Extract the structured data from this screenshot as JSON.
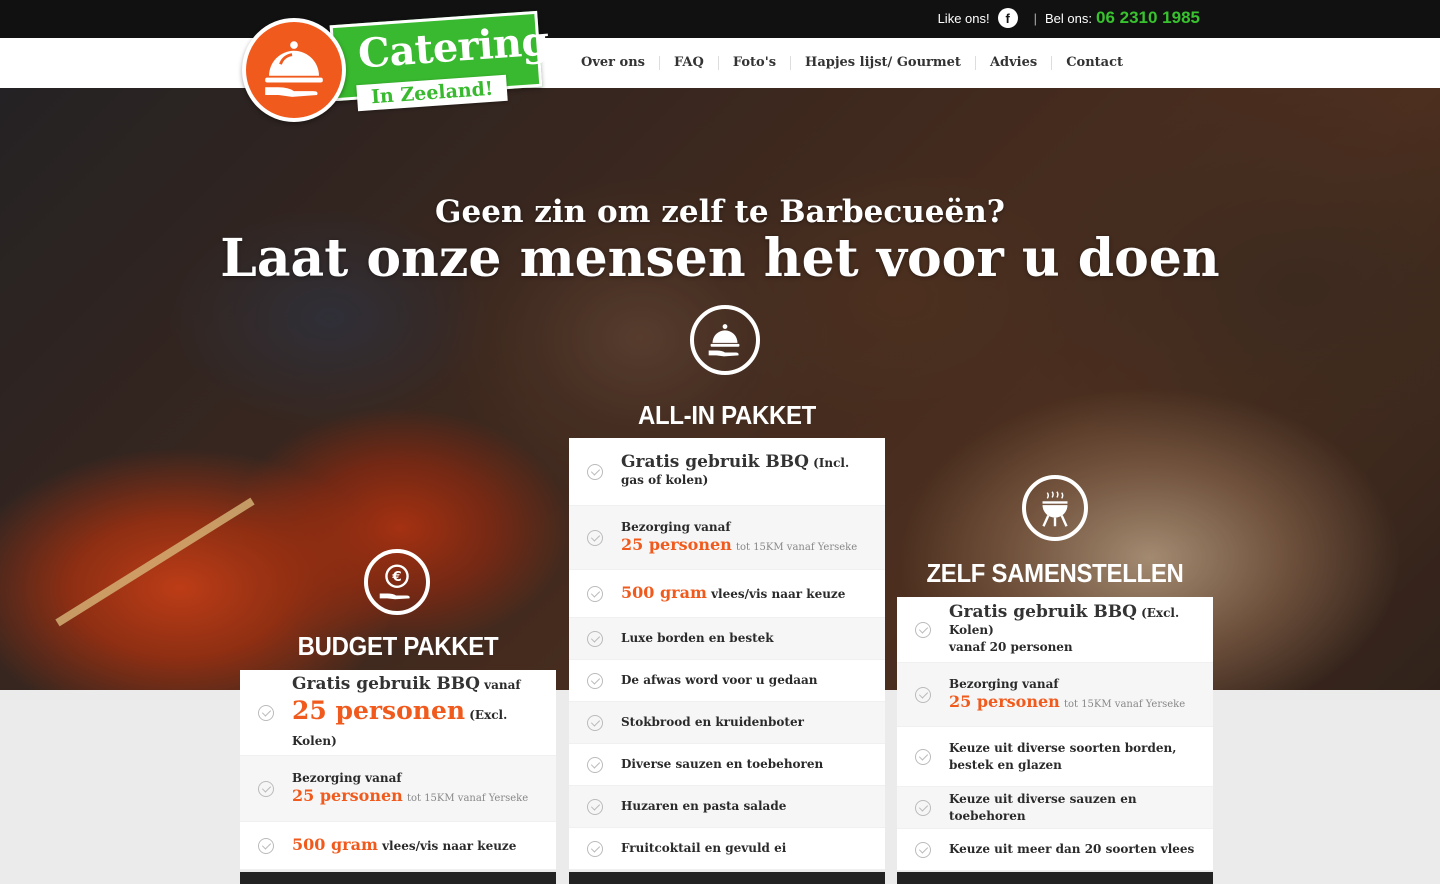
{
  "topbar": {
    "like_label": "Like ons!",
    "fb_icon": "f",
    "separator": "|",
    "call_label": "Bel ons:",
    "phone": "06 2310 1985"
  },
  "logo": {
    "title": "Catering",
    "subtitle": "In Zeeland!"
  },
  "nav": {
    "items": [
      "Over ons",
      "FAQ",
      "Foto's",
      "Hapjes lijst/ Gourmet",
      "Advies",
      "Contact"
    ]
  },
  "hero": {
    "subtitle": "Geen zin om zelf te Barbecueën?",
    "title": "Laat onze mensen het voor u doen"
  },
  "packages": {
    "budget": {
      "title": "BUDGET PAKKET",
      "icon": "euro-hand-icon",
      "rows": [
        {
          "a": "Gratis gebruik BBQ",
          "b": "vanaf",
          "c": "25 personen",
          "d": "(Excl. Kolen)"
        },
        {
          "a": "Bezorging vanaf",
          "b": "25 personen",
          "c": "tot 15KM vanaf Yerseke"
        },
        {
          "a": "500 gram",
          "b": "vlees/vis naar keuze"
        }
      ]
    },
    "allin": {
      "title": "ALL-IN PAKKET",
      "icon": "cloche-hand-icon",
      "rows": [
        {
          "a": "Gratis gebruik BBQ",
          "b": "(Incl. gas of kolen)"
        },
        {
          "a": "Bezorging vanaf",
          "b": "25 personen",
          "c": "tot 15KM vanaf Yerseke"
        },
        {
          "a": "500 gram",
          "b": "vlees/vis naar keuze"
        },
        {
          "a": "Luxe borden en bestek"
        },
        {
          "a": "De afwas word voor u gedaan"
        },
        {
          "a": "Stokbrood en kruidenboter"
        },
        {
          "a": "Diverse sauzen en toebehoren"
        },
        {
          "a": "Huzaren en pasta salade"
        },
        {
          "a": "Fruitcoktail en gevuld ei"
        }
      ]
    },
    "zelf": {
      "title": "ZELF SAMENSTELLEN",
      "icon": "grill-icon",
      "rows": [
        {
          "a": "Gratis gebruik BBQ",
          "b": "(Excl. Kolen)",
          "c": "vanaf 20 personen"
        },
        {
          "a": "Bezorging vanaf",
          "b": "25 personen",
          "c": "tot 15KM vanaf Yerseke"
        },
        {
          "a": "Keuze uit diverse soorten borden, bestek en glazen"
        },
        {
          "a": "Keuze uit diverse sauzen en toebehoren"
        },
        {
          "a": "Keuze uit meer dan 20 soorten vlees"
        }
      ]
    }
  },
  "colors": {
    "brand_orange": "#f15a1d",
    "brand_green": "#39b92f",
    "phone_green": "#38c22e"
  }
}
